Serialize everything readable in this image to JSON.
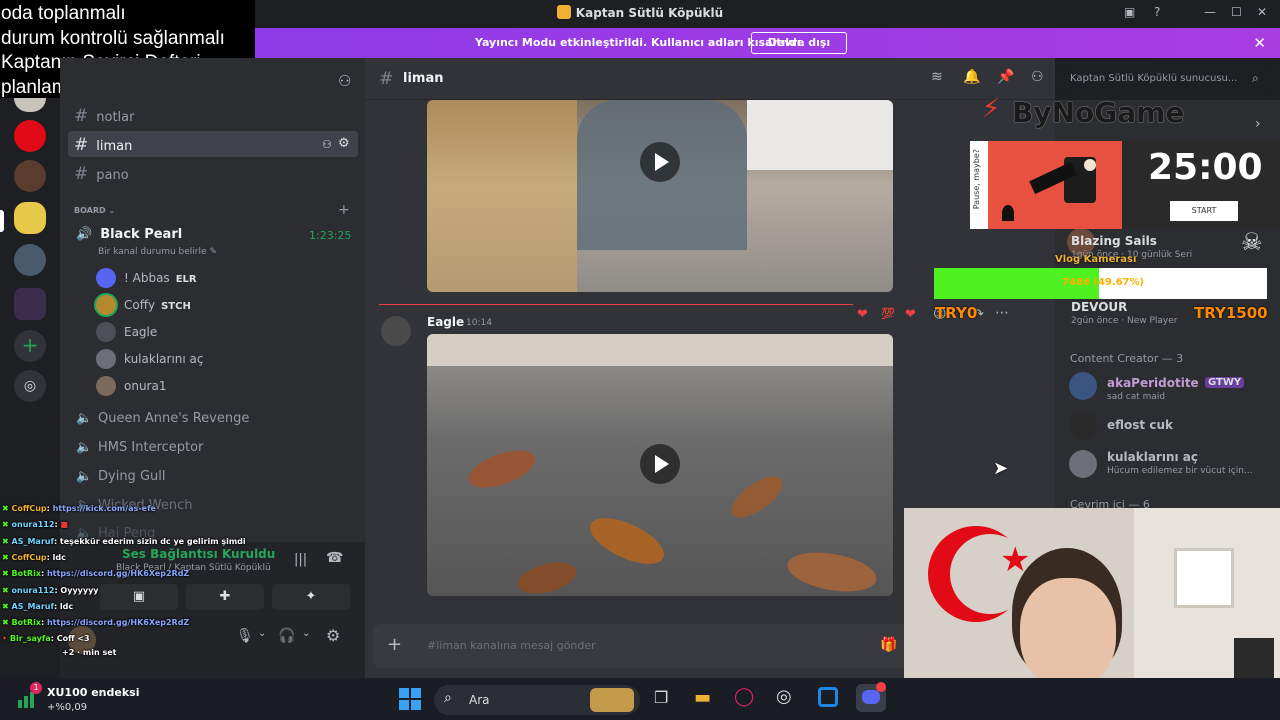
{
  "window": {
    "title": "Kaptan Sütlü Köpüklü"
  },
  "banner": {
    "message": "Yayıncı Modu etkinleştirildi. Kullanıcı adları kısaltıldı.",
    "button": "Devre dışı bırak"
  },
  "overlay_notes": [
    "oda toplanmalı",
    "durum kontrolü sağlanmalı",
    "Kaptanın Seyirci Defteri",
    "planlama"
  ],
  "sidebar": {
    "channels": [
      "notlar",
      "liman",
      "pano"
    ],
    "category": "BOARD",
    "voice_active": {
      "name": "Black Pearl",
      "timer": "1:23:25",
      "status": "Bir kanal durumu belirle"
    },
    "members": [
      {
        "name": "! Abbas",
        "tag": "ELR"
      },
      {
        "name": "Coffy",
        "tag": "STCH"
      },
      {
        "name": "Eagle",
        "tag": ""
      },
      {
        "name": "kulaklarını aç",
        "tag": ""
      },
      {
        "name": "onura1",
        "tag": ""
      }
    ],
    "voice_channels": [
      "Queen Anne's Revenge",
      "HMS Interceptor",
      "Dying Gull",
      "Wicked Wench",
      "Hai Peng"
    ],
    "connection": {
      "title": "Ses Bağlantısı Kuruldu",
      "sub": "Black Pearl / Kaptan Sütlü Köpüklü"
    },
    "user": {
      "name": "Coff",
      "status": "+2 · min set"
    }
  },
  "chat": {
    "channel": "liman",
    "search_placeholder": "Kaptan Sütlü Köpüklü sunucusu...",
    "author": "Eagle",
    "time": "10:14",
    "composer_placeholder": "#liman kanalına mesaj gönder"
  },
  "members_panel": {
    "blazing": {
      "name": "Blazing Sails",
      "sub": "1gün önce · 10 günlük Seri"
    },
    "devour": {
      "name": "DEVOUR",
      "sub": "2gün önce · New Player"
    },
    "section_creator": "Content Creator — 3",
    "creators": [
      {
        "name": "akaPeridotite",
        "tag": "GTWY",
        "sub": "sad cat maid"
      },
      {
        "name": "eflost cuk",
        "tag": "",
        "sub": ""
      },
      {
        "name": "kulaklarını aç",
        "tag": "",
        "sub": "Hücum edilemez bir vücut için..."
      }
    ],
    "section_online": "Çevrim içi — 6"
  },
  "stream_overlay": {
    "brand": "ByNoGame",
    "timer": "25:00",
    "timer_button": "START",
    "pause_text": "Pause, maybe?",
    "webcam_label": "Vlog Kamerası",
    "progress_label": "7486 (49.67%)",
    "progress_value": 49.67,
    "try_left": "TRY0",
    "try_right": "TRY1500"
  },
  "chat_overlay": [
    {
      "user": "CoffCup",
      "msg": "https://kick.com/as-efe",
      "link": true
    },
    {
      "user": "onura112",
      "msg": "",
      "link": false
    },
    {
      "user": "AS_Maruf",
      "msg": "teşekkür ederim sizin dc ye gelirim şimdi",
      "link": false
    },
    {
      "user": "CoffCup",
      "msg": "ldc",
      "link": false
    },
    {
      "user": "BotRix",
      "msg": "https://discord.gg/HK6Xep2RdZ",
      "link": true
    },
    {
      "user": "onura112",
      "msg": "Oyyyyyy",
      "link": false
    },
    {
      "user": "AS_Maruf",
      "msg": "ldc",
      "link": false
    },
    {
      "user": "BotRix",
      "msg": "https://discord.gg/HK6Xep2RdZ",
      "link": true
    },
    {
      "user": "Bir_sayfa",
      "msg": "Coff <3",
      "link": false
    }
  ],
  "taskbar": {
    "ticker_name": "XU100 endeksi",
    "ticker_value": "+%0,09",
    "search": "Ara"
  }
}
